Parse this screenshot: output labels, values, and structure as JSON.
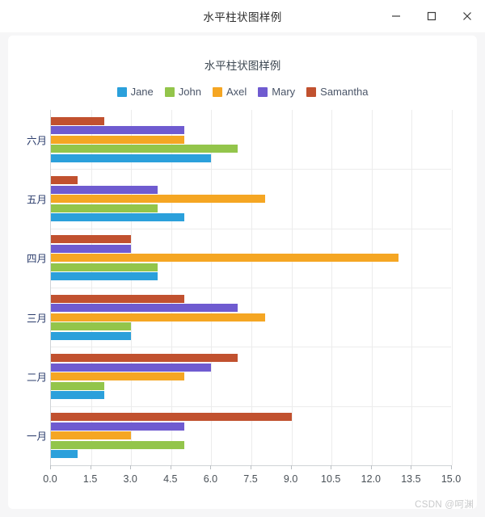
{
  "window": {
    "title": "水平柱状图样例",
    "controls": [
      {
        "name": "minimize-button",
        "label": "—"
      },
      {
        "name": "maximize-button",
        "label": "□"
      },
      {
        "name": "close-button",
        "label": "✕"
      }
    ]
  },
  "watermark": "CSDN @呵渊",
  "colors": {
    "jane": "#2ba0db",
    "john": "#93c54b",
    "axel": "#f5a623",
    "mary": "#6f5bd0",
    "samantha": "#c1512f",
    "grid": "#ececec",
    "axis": "#cfd3d6",
    "ylabel_text": "#2a3b6b",
    "xlabel_text": "#495057",
    "title_text": "#3d4852",
    "card_bg": "#ffffff",
    "window_bg": "#f6f6f7"
  },
  "chart_data": {
    "type": "bar",
    "orientation": "horizontal",
    "title": "水平柱状图样例",
    "xlabel": "",
    "ylabel": "",
    "categories": [
      "一月",
      "二月",
      "三月",
      "四月",
      "五月",
      "六月"
    ],
    "category_order_top_to_bottom": [
      "六月",
      "五月",
      "四月",
      "三月",
      "二月",
      "一月"
    ],
    "xlim": [
      0.0,
      15.0
    ],
    "xticks": [
      0.0,
      1.5,
      3.0,
      4.5,
      6.0,
      7.5,
      9.0,
      10.5,
      12.0,
      13.5,
      15.0
    ],
    "xticklabels": [
      "0.0",
      "1.5",
      "3.0",
      "4.5",
      "6.0",
      "7.5",
      "9.0",
      "10.5",
      "12.0",
      "13.5",
      "15.0"
    ],
    "grid": true,
    "grid_axis": "both",
    "legend_position": "top-center",
    "series": [
      {
        "name": "Jane",
        "color": "#2ba0db",
        "values": [
          1.0,
          2.0,
          3.0,
          4.0,
          5.0,
          6.0
        ]
      },
      {
        "name": "John",
        "color": "#93c54b",
        "values": [
          5.0,
          2.0,
          3.0,
          4.0,
          4.0,
          7.0
        ]
      },
      {
        "name": "Axel",
        "color": "#f5a623",
        "values": [
          3.0,
          5.0,
          8.0,
          13.0,
          8.0,
          5.0
        ]
      },
      {
        "name": "Mary",
        "color": "#6f5bd0",
        "values": [
          5.0,
          6.0,
          7.0,
          3.0,
          4.0,
          5.0
        ]
      },
      {
        "name": "Samantha",
        "color": "#c1512f",
        "values": [
          9.0,
          7.0,
          5.0,
          3.0,
          1.0,
          2.0
        ]
      }
    ]
  }
}
